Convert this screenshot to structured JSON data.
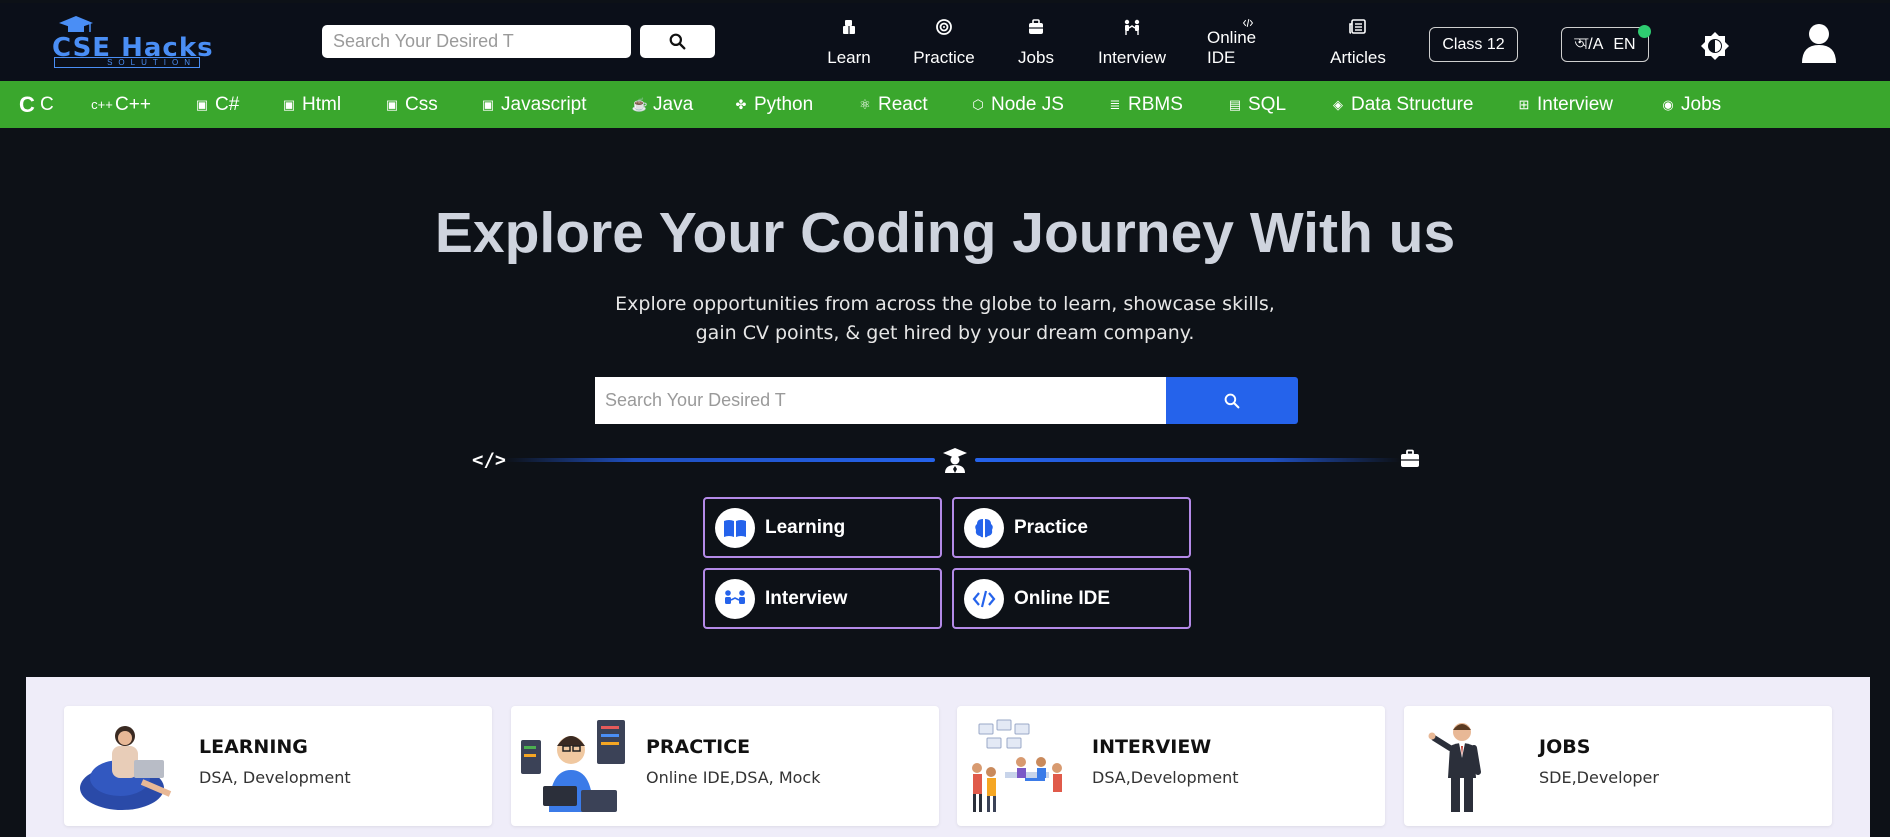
{
  "header": {
    "logo_title": "CSE Hacks",
    "logo_sub": "SOLUTION",
    "search_placeholder": "Search Your Desired T",
    "nav": [
      {
        "label": "Learn",
        "icon": "book-stack-icon"
      },
      {
        "label": "Practice",
        "icon": "target-icon"
      },
      {
        "label": "Jobs",
        "icon": "briefcase-icon"
      },
      {
        "label": "Interview",
        "icon": "people-icon"
      },
      {
        "label": "Online IDE",
        "icon": "code-icon"
      },
      {
        "label": "Articles",
        "icon": "newspaper-icon"
      }
    ],
    "class_label": "Class 12",
    "lang_bn": "অ/A",
    "lang_en": "EN"
  },
  "categories": [
    {
      "label": "C"
    },
    {
      "label": "C++"
    },
    {
      "label": "C#"
    },
    {
      "label": "Html"
    },
    {
      "label": "Css"
    },
    {
      "label": "Javascript"
    },
    {
      "label": "Java"
    },
    {
      "label": "Python"
    },
    {
      "label": "React"
    },
    {
      "label": "Node JS"
    },
    {
      "label": "RBMS"
    },
    {
      "label": "SQL"
    },
    {
      "label": "Data Structure"
    },
    {
      "label": "Interview"
    },
    {
      "label": "Jobs"
    }
  ],
  "hero": {
    "title": "Explore Your Coding Journey With us",
    "subtitle_line1": "Explore opportunities from across the globe to learn, showcase skills,",
    "subtitle_line2": "gain CV points, & get hired by your dream company.",
    "search_placeholder": "Search Your Desired T",
    "code_symbol": "</>"
  },
  "quick_links": [
    {
      "label": "Learning",
      "icon": "open-book-icon"
    },
    {
      "label": "Practice",
      "icon": "brain-icon"
    },
    {
      "label": "Interview",
      "icon": "people-icon"
    },
    {
      "label": "Online IDE",
      "icon": "code-icon"
    }
  ],
  "cards": [
    {
      "title": "LEARNING",
      "subtitle": "DSA, Development"
    },
    {
      "title": "PRACTICE",
      "subtitle": "Online IDE,DSA, Mock"
    },
    {
      "title": "INTERVIEW",
      "subtitle": "DSA,Development"
    },
    {
      "title": "JOBS",
      "subtitle": "SDE,Developer"
    }
  ],
  "colors": {
    "accent": "#2563eb",
    "green_bar": "#3aa72d",
    "card_border": "#b48ae8",
    "background": "#0d1117"
  }
}
